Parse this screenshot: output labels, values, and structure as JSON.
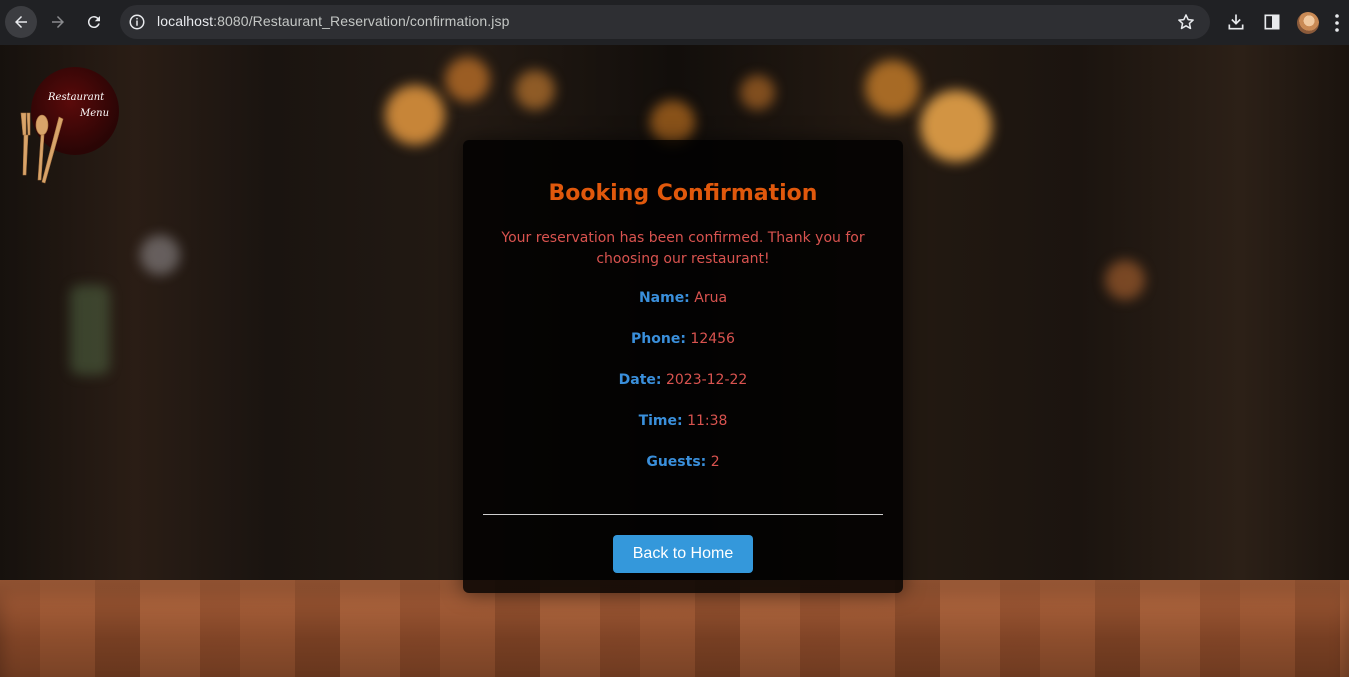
{
  "browser": {
    "url_host": "localhost",
    "url_path": ":8080/Restaurant_Reservation/confirmation.jsp"
  },
  "logo": {
    "word1": "Restaurant",
    "word2": "Menu"
  },
  "confirmation": {
    "title": "Booking Confirmation",
    "message": "Your reservation has been confirmed. Thank you for choosing our restaurant!",
    "details": {
      "name_label": "Name:",
      "name_value": "Arua",
      "phone_label": "Phone:",
      "phone_value": "12456",
      "date_label": "Date:",
      "date_value": "2023-12-22",
      "time_label": "Time:",
      "time_value": "11:38",
      "guests_label": "Guests:",
      "guests_value": "2"
    },
    "back_button": "Back to Home"
  },
  "colors": {
    "title": "#e0580c",
    "message": "#d9534f",
    "label": "#3a8fdb",
    "button": "#3498db"
  },
  "icons": [
    "back-arrow-icon",
    "forward-arrow-icon",
    "reload-icon",
    "site-info-icon",
    "bookmark-star-icon",
    "download-icon",
    "side-panel-icon",
    "profile-avatar",
    "more-menu-icon"
  ]
}
